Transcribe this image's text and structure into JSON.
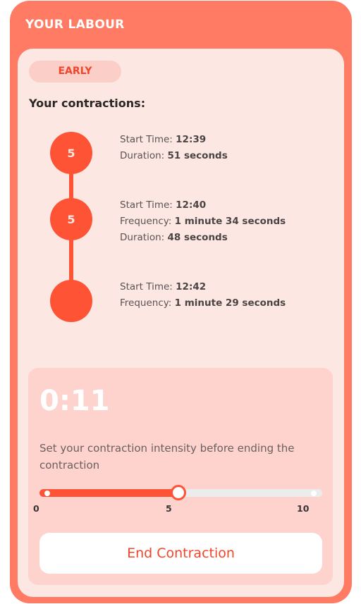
{
  "header": {
    "title": "YOUR LABOUR"
  },
  "stage": {
    "label": "EARLY"
  },
  "contractions": {
    "title": "Your contractions:",
    "items": [
      {
        "intensity": "5",
        "start_label": "Start Time:",
        "start_value": "12:39",
        "duration_label": "Duration:",
        "duration_value": "51 seconds"
      },
      {
        "intensity": "5",
        "start_label": "Start Time:",
        "start_value": "12:40",
        "frequency_label": "Frequency:",
        "frequency_value": "1 minute 34 seconds",
        "duration_label": "Duration:",
        "duration_value": "48 seconds"
      },
      {
        "intensity": "",
        "start_label": "Start Time:",
        "start_value": "12:42",
        "frequency_label": "Frequency:",
        "frequency_value": "1 minute 29 seconds"
      }
    ]
  },
  "timer": {
    "elapsed": "0:11",
    "prompt": "Set your contraction intensity before ending the contraction"
  },
  "intensity_slider": {
    "min": 0,
    "max": 10,
    "value": 5,
    "min_label": "0",
    "mid_label": "5",
    "max_label": "10"
  },
  "actions": {
    "end_label": "End Contraction"
  },
  "colors": {
    "accent": "#ff5335",
    "frame": "#ff7b63",
    "card": "#fde7e3",
    "panel": "#fed3cd"
  }
}
